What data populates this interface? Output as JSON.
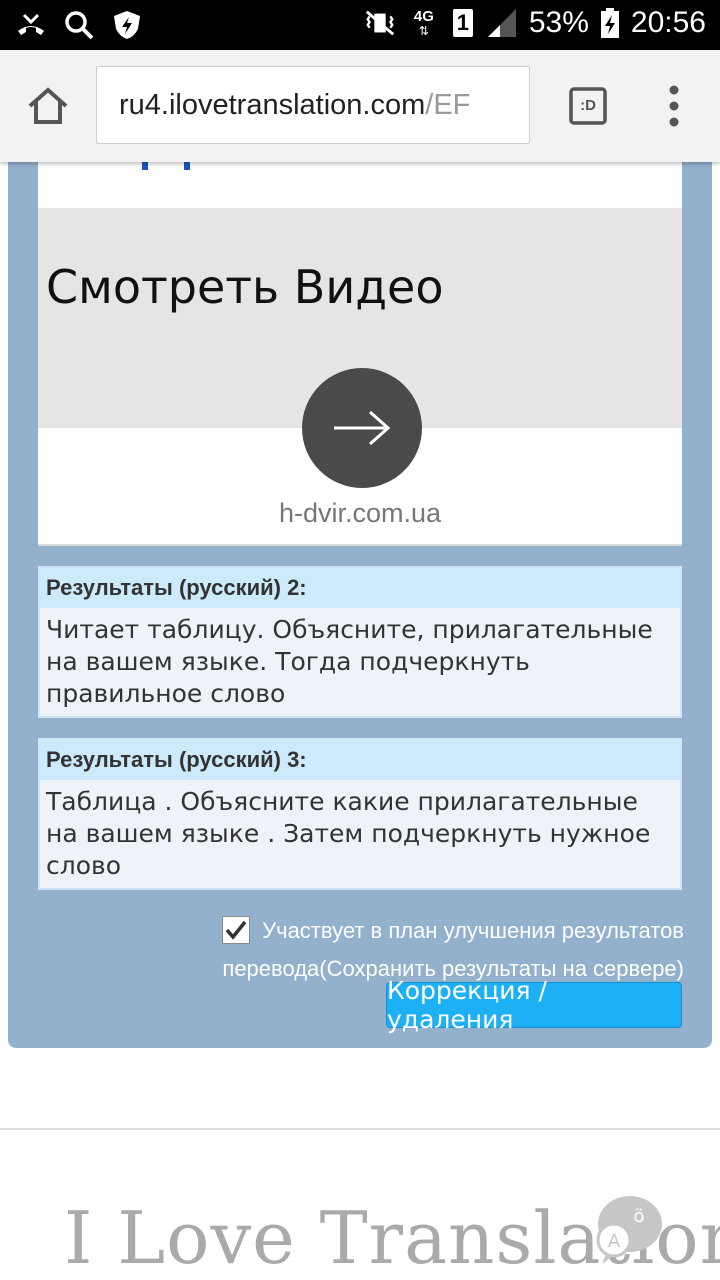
{
  "status_bar": {
    "battery_percent": "53%",
    "sim_slot": "1",
    "network": "4G",
    "time": "20:56",
    "icons": [
      "missed-call-icon",
      "search-icon",
      "shield-icon",
      "vibrate-mute-icon",
      "signal-icon",
      "battery-charging-icon"
    ]
  },
  "browser": {
    "url_host": "ru4.ilovetranslation.com",
    "url_path": "/EF",
    "tabs_label": ":D"
  },
  "ad": {
    "title": "Смотреть Видео",
    "domain": "h-dvir.com.ua"
  },
  "results": [
    {
      "header": "Результаты (русский) 2:",
      "text": "Читает таблицу. Объясните, прилагательные на вашем языке. Тогда подчеркнуть правильное слово"
    },
    {
      "header": "Результаты (русский) 3:",
      "text": "Таблица . Объясните какие прилагательные на вашем языке . Затем подчеркнуть нужное слово"
    }
  ],
  "agree": {
    "label": "Участвует в план улучшения результатов перевода(Сохранить результаты на сервере)",
    "checked": true
  },
  "buttons": {
    "correction_label": "Коррекция / удаления"
  },
  "footer": {
    "logo_text": "I Love Translation"
  },
  "colors": {
    "panel": "#93b0cd",
    "result_header": "#cdeafb",
    "button": "#1eb0f5"
  }
}
